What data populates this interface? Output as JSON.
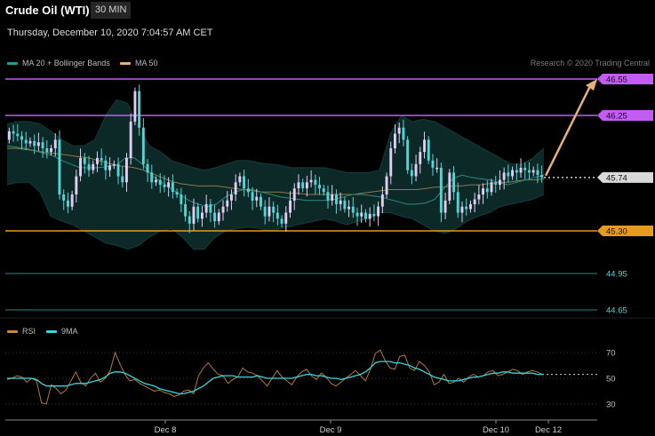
{
  "header": {
    "title": "Crude Oil (WTI)",
    "timeframe": "30 MIN",
    "datetime": "Thursday, December 10, 2020 7:04:57 AM CET"
  },
  "price_legend": [
    {
      "label": "MA 20 + Bollinger Bands",
      "color": "#1aa39a"
    },
    {
      "label": "MA 50",
      "color": "#e8b07a"
    }
  ],
  "credit": "Research © 2020 Trading Central",
  "rsi_legend": [
    {
      "label": "RSI",
      "color": "#c28a3c"
    },
    {
      "label": "9MA",
      "color": "#36d7e0"
    }
  ],
  "colors": {
    "up_candle": "#e1cdf2",
    "down_candle": "#4fd6d6",
    "resistance": "#c35cf2",
    "support": "#e69a1e",
    "support_lower": "#1f8a85",
    "current_label_bg": "#d9d9d9",
    "forecast_arrow": "#e8b07a"
  },
  "chart_data": [
    {
      "type": "candlestick",
      "title": "Crude Oil (WTI)",
      "timeframe": "30 MIN",
      "x_tick_labels": [
        "Dec 8",
        "Dec 9",
        "Dec 10",
        "Dec 12"
      ],
      "ylim": [
        44.62,
        46.58
      ],
      "current_price": 45.74,
      "horizontal_levels": [
        {
          "value": 46.55,
          "label": "46.55",
          "kind": "resistance"
        },
        {
          "value": 46.25,
          "label": "46.25",
          "kind": "resistance"
        },
        {
          "value": 45.3,
          "label": "45.30",
          "kind": "support"
        },
        {
          "value": 44.95,
          "label": "44.95",
          "kind": "support"
        },
        {
          "value": 44.65,
          "label": "44.65",
          "kind": "support"
        }
      ],
      "forecast_target": 46.55,
      "close_series": [
        46.12,
        46.1,
        46.08,
        46.05,
        46.02,
        46.04,
        46.0,
        46.03,
        45.98,
        45.95,
        45.98,
        46.05,
        45.6,
        45.55,
        45.5,
        45.6,
        45.75,
        45.9,
        45.85,
        45.8,
        45.85,
        45.9,
        45.88,
        45.8,
        45.84,
        45.85,
        45.75,
        45.7,
        45.9,
        46.2,
        46.45,
        46.15,
        45.85,
        45.78,
        45.7,
        45.72,
        45.68,
        45.66,
        45.7,
        45.62,
        45.6,
        45.52,
        45.42,
        45.36,
        45.5,
        45.4,
        45.45,
        45.52,
        45.45,
        45.38,
        45.45,
        45.5,
        45.55,
        45.6,
        45.7,
        45.75,
        45.65,
        45.62,
        45.55,
        45.58,
        45.5,
        45.42,
        45.5,
        45.45,
        45.4,
        45.36,
        45.45,
        45.55,
        45.65,
        45.7,
        45.65,
        45.7,
        45.72,
        45.68,
        45.65,
        45.62,
        45.55,
        45.6,
        45.52,
        45.55,
        45.48,
        45.5,
        45.45,
        45.42,
        45.45,
        45.4,
        45.44,
        45.42,
        45.5,
        45.6,
        45.75,
        45.98,
        46.1,
        46.15,
        46.05,
        45.8,
        45.75,
        45.85,
        45.95,
        46.05,
        45.88,
        45.82,
        45.82,
        45.45,
        45.55,
        45.78,
        45.62,
        45.45,
        45.5,
        45.48,
        45.52,
        45.56,
        45.6,
        45.65,
        45.62,
        45.7,
        45.68,
        45.72,
        45.78,
        45.75,
        45.8,
        45.78,
        45.82,
        45.8,
        45.78,
        45.8,
        45.76,
        45.74
      ],
      "open_series": [
        46.05,
        46.12,
        46.1,
        46.08,
        46.05,
        46.02,
        46.04,
        46.0,
        46.03,
        45.98,
        45.95,
        45.98,
        46.05,
        45.6,
        45.55,
        45.5,
        45.6,
        45.75,
        45.9,
        45.85,
        45.8,
        45.85,
        45.9,
        45.88,
        45.8,
        45.84,
        45.85,
        45.75,
        45.7,
        45.9,
        46.2,
        46.45,
        46.15,
        45.85,
        45.78,
        45.7,
        45.72,
        45.68,
        45.66,
        45.7,
        45.62,
        45.6,
        45.52,
        45.42,
        45.36,
        45.5,
        45.4,
        45.45,
        45.52,
        45.45,
        45.38,
        45.45,
        45.5,
        45.55,
        45.6,
        45.7,
        45.75,
        45.65,
        45.62,
        45.55,
        45.58,
        45.5,
        45.42,
        45.5,
        45.45,
        45.4,
        45.36,
        45.45,
        45.55,
        45.65,
        45.7,
        45.65,
        45.7,
        45.72,
        45.68,
        45.65,
        45.62,
        45.55,
        45.6,
        45.52,
        45.55,
        45.48,
        45.5,
        45.45,
        45.42,
        45.45,
        45.4,
        45.44,
        45.42,
        45.5,
        45.6,
        45.75,
        45.98,
        46.1,
        46.15,
        46.05,
        45.8,
        45.75,
        45.85,
        45.95,
        46.05,
        45.88,
        45.82,
        45.82,
        45.45,
        45.55,
        45.78,
        45.62,
        45.45,
        45.5,
        45.48,
        45.52,
        45.56,
        45.6,
        45.65,
        45.62,
        45.7,
        45.68,
        45.72,
        45.78,
        45.75,
        45.8,
        45.78,
        45.82,
        45.8,
        45.78,
        45.8,
        45.76
      ],
      "ma20_series": [
        46.0,
        45.99,
        45.98,
        45.96,
        45.94,
        45.92,
        45.88,
        45.85,
        45.82,
        45.82,
        45.82,
        45.83,
        45.84,
        45.9,
        45.9,
        45.84,
        45.75,
        45.7,
        45.65,
        45.6,
        45.55,
        45.52,
        45.5,
        45.52,
        45.58,
        45.62,
        45.64,
        45.64,
        45.62,
        45.6,
        45.58,
        45.57,
        45.56,
        45.55,
        45.55,
        45.55,
        45.56,
        45.58,
        45.6,
        45.6,
        45.59,
        45.58,
        45.56,
        45.54,
        45.52,
        45.52,
        45.53,
        45.56,
        45.65,
        45.73,
        45.76,
        45.74,
        45.73,
        45.72,
        45.7,
        45.68,
        45.7,
        45.72,
        45.74,
        45.76
      ],
      "ma50_series": [
        45.98,
        45.98,
        45.97,
        45.96,
        45.95,
        45.94,
        45.93,
        45.92,
        45.91,
        45.9,
        45.88,
        45.86,
        45.84,
        45.83,
        45.82,
        45.8,
        45.77,
        45.74,
        45.71,
        45.69,
        45.68,
        45.67,
        45.67,
        45.67,
        45.66,
        45.65,
        45.64,
        45.63,
        45.62,
        45.62,
        45.62,
        45.61,
        45.61,
        45.6,
        45.6,
        45.6,
        45.6,
        45.6,
        45.6,
        45.61,
        45.62,
        45.63,
        45.64,
        45.64,
        45.64,
        45.64,
        45.65,
        45.66,
        45.66,
        45.67,
        45.67,
        45.68,
        45.68,
        45.69,
        45.7,
        45.7,
        45.71,
        45.72,
        45.72,
        45.73
      ],
      "bollinger_upper": [
        46.18,
        46.2,
        46.2,
        46.18,
        46.12,
        46.05,
        46.0,
        46.0,
        46.05,
        46.25,
        46.38,
        46.35,
        46.15,
        46.0,
        45.95,
        45.88,
        45.85,
        45.82,
        45.8,
        45.82,
        45.85,
        45.88,
        45.88,
        45.86,
        45.85,
        45.84,
        45.82,
        45.82,
        45.82,
        45.82,
        45.8,
        45.78,
        45.78,
        45.78,
        45.8,
        46.1,
        46.25,
        46.2,
        46.22,
        46.2,
        46.15,
        46.1,
        46.05,
        46.0,
        45.95,
        45.9,
        45.85,
        45.85,
        45.9,
        45.98
      ],
      "bollinger_lower": [
        45.68,
        45.7,
        45.7,
        45.62,
        45.42,
        45.38,
        45.35,
        45.3,
        45.25,
        45.2,
        45.18,
        45.15,
        45.18,
        45.25,
        45.3,
        45.32,
        45.25,
        45.15,
        45.15,
        45.25,
        45.3,
        45.32,
        45.33,
        45.32,
        45.3,
        45.32,
        45.34,
        45.36,
        45.38,
        45.4,
        45.38,
        45.35,
        45.38,
        45.4,
        45.45,
        45.45,
        45.42,
        45.4,
        45.35,
        45.3,
        45.28,
        45.32,
        45.38,
        45.42,
        45.45,
        45.5,
        45.52,
        45.54,
        45.56,
        45.6
      ]
    },
    {
      "type": "line",
      "title": "RSI",
      "y_tick_labels": [
        "70",
        "50",
        "30"
      ],
      "ylim": [
        25,
        75
      ],
      "series": [
        {
          "name": "RSI",
          "values": [
            49,
            50,
            52,
            51,
            47,
            50,
            48,
            31,
            30,
            45,
            42,
            38,
            41,
            48,
            55,
            47,
            44,
            50,
            54,
            47,
            50,
            56,
            70,
            61,
            53,
            48,
            49,
            46,
            44,
            42,
            40,
            41,
            39,
            38,
            36,
            37,
            40,
            41,
            38,
            52,
            58,
            62,
            57,
            53,
            52,
            46,
            49,
            51,
            58,
            55,
            54,
            52,
            48,
            44,
            50,
            56,
            51,
            48,
            45,
            51,
            55,
            57,
            52,
            49,
            54,
            51,
            46,
            44,
            47,
            50,
            53,
            56,
            52,
            48,
            57,
            69,
            72,
            64,
            58,
            57,
            67,
            68,
            58,
            56,
            63,
            60,
            55,
            45,
            47,
            53,
            46,
            47,
            50,
            47,
            51,
            53,
            51,
            52,
            55,
            56,
            52,
            53,
            55,
            57,
            56,
            53,
            55,
            56,
            55,
            53
          ]
        },
        {
          "name": "9MA",
          "values": [
            50,
            50,
            50,
            50,
            50,
            50,
            49,
            46,
            44,
            44,
            44,
            44,
            44,
            45,
            46,
            46,
            46,
            47,
            48,
            49,
            51,
            54,
            55,
            55,
            54,
            52,
            50,
            48,
            46,
            45,
            44,
            42,
            41,
            40,
            39,
            38,
            38,
            39,
            40,
            42,
            44,
            47,
            50,
            51,
            52,
            52,
            52,
            51,
            51,
            51,
            51,
            52,
            51,
            50,
            50,
            50,
            50,
            50,
            50,
            51,
            52,
            53,
            53,
            52,
            52,
            51,
            50,
            50,
            49,
            50,
            51,
            52,
            53,
            55,
            58,
            62,
            63,
            63,
            63,
            62,
            62,
            61,
            60,
            58,
            57,
            55,
            53,
            51,
            50,
            49,
            48,
            48,
            48,
            49,
            50,
            51,
            51,
            52,
            53,
            54,
            54,
            55,
            55,
            54,
            54,
            54,
            54,
            54,
            53,
            53
          ]
        }
      ],
      "dotted_reference": 53
    }
  ]
}
